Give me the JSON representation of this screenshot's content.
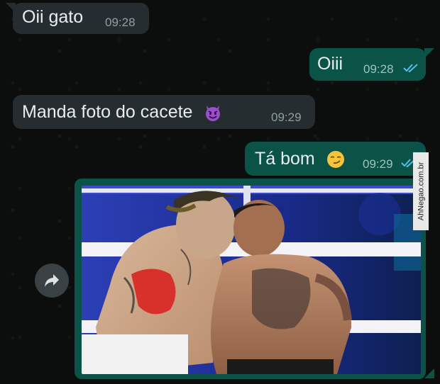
{
  "messages": [
    {
      "direction": "in",
      "text": "Oii gato",
      "time": "09:28"
    },
    {
      "direction": "out",
      "text": "Oiii",
      "time": "09:28",
      "status": "read"
    },
    {
      "direction": "in",
      "text": "Manda foto do cacete",
      "time": "09:29",
      "emoji": "smiling-face-with-horns"
    },
    {
      "direction": "out",
      "text": "Tá bom",
      "time": "09:29",
      "status": "read",
      "emoji": "smirking-face"
    }
  ],
  "media_message": {
    "direction": "out",
    "kind": "image",
    "content": "boxing-match-photo"
  },
  "watermark": {
    "text": "AhNegao.com.br"
  },
  "colors": {
    "incoming_bubble": "#262d31",
    "outgoing_bubble": "#0a5346",
    "read_ticks": "#53bdeb",
    "background": "#0c0e0d"
  },
  "icons": [
    "forward-icon",
    "double-check-icon",
    "smiling-face-with-horns-emoji",
    "smirking-face-emoji"
  ]
}
